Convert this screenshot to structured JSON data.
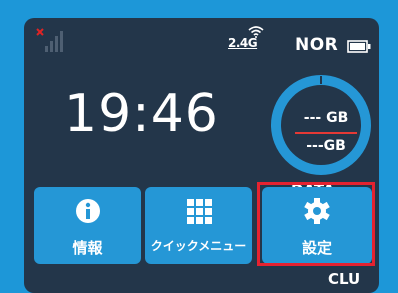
{
  "status": {
    "band": "2.4G",
    "mode": "NOR"
  },
  "clock": "19:46",
  "data_usage": {
    "used": "--- GB",
    "total": "---GB",
    "label": "DATA"
  },
  "tiles": [
    {
      "label": "情報",
      "icon": "info-icon"
    },
    {
      "label": "クイックメニュー",
      "icon": "grid-icon"
    },
    {
      "label": "設定",
      "icon": "gear-icon"
    }
  ],
  "profile": "CLU",
  "colors": {
    "screen_bg": "#23364a",
    "tile": "#2597d6",
    "accent_red": "#e52230",
    "frame": "#1d97d8"
  }
}
